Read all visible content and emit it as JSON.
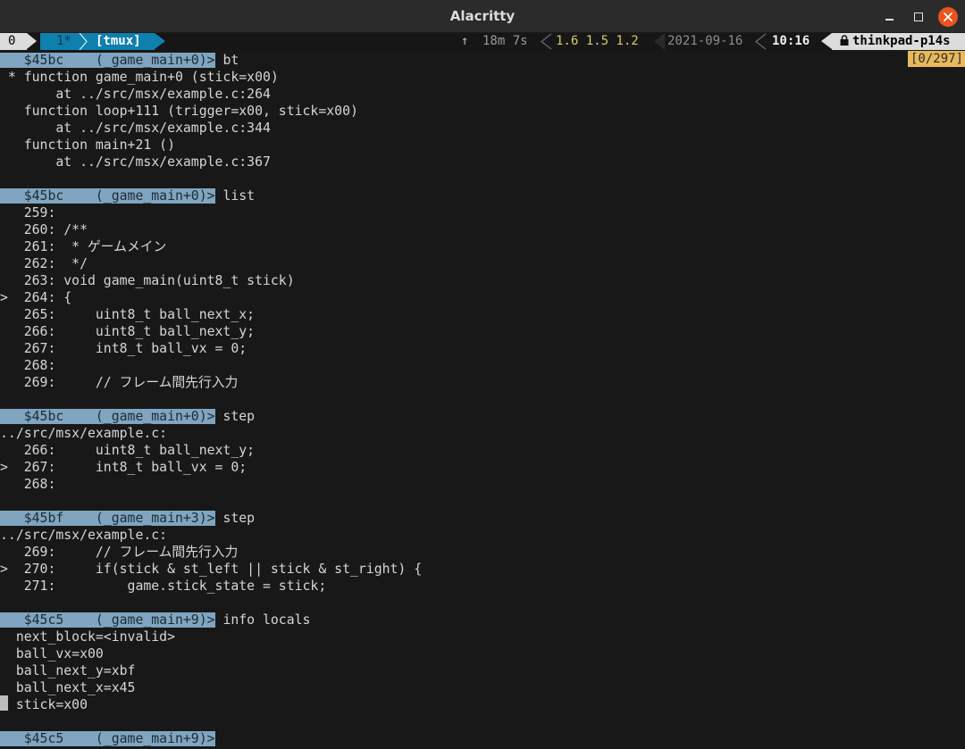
{
  "window": {
    "title": "Alacritty"
  },
  "statusbar": {
    "window0": "0",
    "window1": "1*",
    "session": "[tmux]",
    "uptime_icon": "↑",
    "uptime": "18m 7s",
    "load": "1.6 1.5 1.2",
    "date": "2021-09-16",
    "time": "10:16",
    "hostname": "thinkpad-p14s",
    "colors": {
      "session_bg": "#0f7fae",
      "prompt_bg": "#7fa5c0",
      "load_fg": "#d4cc6a",
      "indicator_bg": "#e7b95a",
      "close_btn": "#e95420"
    }
  },
  "terminal": {
    "scroll_indicator": "[0/297]",
    "prompt_width_chars": 28,
    "lines": [
      {
        "type": "prompt",
        "prompt": "   $45bc    (_game_main+0)>",
        "cmd": " bt"
      },
      {
        "type": "text",
        "text": " * function game_main+0 (stick=x00)"
      },
      {
        "type": "text",
        "text": "       at ../src/msx/example.c:264"
      },
      {
        "type": "text",
        "text": "   function loop+111 (trigger=x00, stick=x00)"
      },
      {
        "type": "text",
        "text": "       at ../src/msx/example.c:344"
      },
      {
        "type": "text",
        "text": "   function main+21 ()"
      },
      {
        "type": "text",
        "text": "       at ../src/msx/example.c:367"
      },
      {
        "type": "text",
        "text": ""
      },
      {
        "type": "prompt",
        "prompt": "   $45bc    (_game_main+0)>",
        "cmd": " list"
      },
      {
        "type": "text",
        "text": "   259:"
      },
      {
        "type": "text",
        "text": "   260: /**"
      },
      {
        "type": "text",
        "text": "   261:  * ゲームメイン"
      },
      {
        "type": "text",
        "text": "   262:  */"
      },
      {
        "type": "text",
        "text": "   263: void game_main(uint8_t stick)"
      },
      {
        "type": "text",
        "text": ">  264: {"
      },
      {
        "type": "text",
        "text": "   265:     uint8_t ball_next_x;"
      },
      {
        "type": "text",
        "text": "   266:     uint8_t ball_next_y;"
      },
      {
        "type": "text",
        "text": "   267:     int8_t ball_vx = 0;"
      },
      {
        "type": "text",
        "text": "   268:"
      },
      {
        "type": "text",
        "text": "   269:     // フレーム間先行入力"
      },
      {
        "type": "text",
        "text": ""
      },
      {
        "type": "prompt",
        "prompt": "   $45bc    (_game_main+0)>",
        "cmd": " step"
      },
      {
        "type": "text",
        "text": "../src/msx/example.c:"
      },
      {
        "type": "text",
        "text": "   266:     uint8_t ball_next_y;"
      },
      {
        "type": "text",
        "text": ">  267:     int8_t ball_vx = 0;"
      },
      {
        "type": "text",
        "text": "   268:"
      },
      {
        "type": "text",
        "text": ""
      },
      {
        "type": "prompt",
        "prompt": "   $45bf    (_game_main+3)>",
        "cmd": " step"
      },
      {
        "type": "text",
        "text": "../src/msx/example.c:"
      },
      {
        "type": "text",
        "text": "   269:     // フレーム間先行入力"
      },
      {
        "type": "text",
        "text": ">  270:     if(stick & st_left || stick & st_right) {"
      },
      {
        "type": "text",
        "text": "   271:         game.stick_state = stick;"
      },
      {
        "type": "text",
        "text": ""
      },
      {
        "type": "prompt",
        "prompt": "   $45c5    (_game_main+9)>",
        "cmd": " info locals"
      },
      {
        "type": "text",
        "text": "  next_block=<invalid>"
      },
      {
        "type": "text",
        "text": "  ball_vx=x00"
      },
      {
        "type": "text",
        "text": "  ball_next_y=xbf"
      },
      {
        "type": "text",
        "text": "  ball_next_x=x45"
      },
      {
        "type": "text",
        "text": "  stick=x00"
      },
      {
        "type": "text",
        "text": ""
      },
      {
        "type": "prompt",
        "prompt": "   $45c5    (_game_main+9)>",
        "cmd": ""
      }
    ]
  }
}
